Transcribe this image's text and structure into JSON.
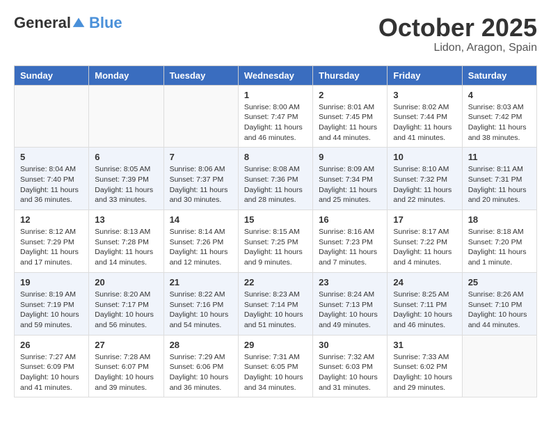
{
  "header": {
    "logo_general": "General",
    "logo_blue": "Blue",
    "title": "October 2025",
    "location": "Lidon, Aragon, Spain"
  },
  "weekdays": [
    "Sunday",
    "Monday",
    "Tuesday",
    "Wednesday",
    "Thursday",
    "Friday",
    "Saturday"
  ],
  "weeks": [
    [
      {
        "day": "",
        "sunrise": "",
        "sunset": "",
        "daylight": ""
      },
      {
        "day": "",
        "sunrise": "",
        "sunset": "",
        "daylight": ""
      },
      {
        "day": "",
        "sunrise": "",
        "sunset": "",
        "daylight": ""
      },
      {
        "day": "1",
        "sunrise": "Sunrise: 8:00 AM",
        "sunset": "Sunset: 7:47 PM",
        "daylight": "Daylight: 11 hours and 46 minutes."
      },
      {
        "day": "2",
        "sunrise": "Sunrise: 8:01 AM",
        "sunset": "Sunset: 7:45 PM",
        "daylight": "Daylight: 11 hours and 44 minutes."
      },
      {
        "day": "3",
        "sunrise": "Sunrise: 8:02 AM",
        "sunset": "Sunset: 7:44 PM",
        "daylight": "Daylight: 11 hours and 41 minutes."
      },
      {
        "day": "4",
        "sunrise": "Sunrise: 8:03 AM",
        "sunset": "Sunset: 7:42 PM",
        "daylight": "Daylight: 11 hours and 38 minutes."
      }
    ],
    [
      {
        "day": "5",
        "sunrise": "Sunrise: 8:04 AM",
        "sunset": "Sunset: 7:40 PM",
        "daylight": "Daylight: 11 hours and 36 minutes."
      },
      {
        "day": "6",
        "sunrise": "Sunrise: 8:05 AM",
        "sunset": "Sunset: 7:39 PM",
        "daylight": "Daylight: 11 hours and 33 minutes."
      },
      {
        "day": "7",
        "sunrise": "Sunrise: 8:06 AM",
        "sunset": "Sunset: 7:37 PM",
        "daylight": "Daylight: 11 hours and 30 minutes."
      },
      {
        "day": "8",
        "sunrise": "Sunrise: 8:08 AM",
        "sunset": "Sunset: 7:36 PM",
        "daylight": "Daylight: 11 hours and 28 minutes."
      },
      {
        "day": "9",
        "sunrise": "Sunrise: 8:09 AM",
        "sunset": "Sunset: 7:34 PM",
        "daylight": "Daylight: 11 hours and 25 minutes."
      },
      {
        "day": "10",
        "sunrise": "Sunrise: 8:10 AM",
        "sunset": "Sunset: 7:32 PM",
        "daylight": "Daylight: 11 hours and 22 minutes."
      },
      {
        "day": "11",
        "sunrise": "Sunrise: 8:11 AM",
        "sunset": "Sunset: 7:31 PM",
        "daylight": "Daylight: 11 hours and 20 minutes."
      }
    ],
    [
      {
        "day": "12",
        "sunrise": "Sunrise: 8:12 AM",
        "sunset": "Sunset: 7:29 PM",
        "daylight": "Daylight: 11 hours and 17 minutes."
      },
      {
        "day": "13",
        "sunrise": "Sunrise: 8:13 AM",
        "sunset": "Sunset: 7:28 PM",
        "daylight": "Daylight: 11 hours and 14 minutes."
      },
      {
        "day": "14",
        "sunrise": "Sunrise: 8:14 AM",
        "sunset": "Sunset: 7:26 PM",
        "daylight": "Daylight: 11 hours and 12 minutes."
      },
      {
        "day": "15",
        "sunrise": "Sunrise: 8:15 AM",
        "sunset": "Sunset: 7:25 PM",
        "daylight": "Daylight: 11 hours and 9 minutes."
      },
      {
        "day": "16",
        "sunrise": "Sunrise: 8:16 AM",
        "sunset": "Sunset: 7:23 PM",
        "daylight": "Daylight: 11 hours and 7 minutes."
      },
      {
        "day": "17",
        "sunrise": "Sunrise: 8:17 AM",
        "sunset": "Sunset: 7:22 PM",
        "daylight": "Daylight: 11 hours and 4 minutes."
      },
      {
        "day": "18",
        "sunrise": "Sunrise: 8:18 AM",
        "sunset": "Sunset: 7:20 PM",
        "daylight": "Daylight: 11 hours and 1 minute."
      }
    ],
    [
      {
        "day": "19",
        "sunrise": "Sunrise: 8:19 AM",
        "sunset": "Sunset: 7:19 PM",
        "daylight": "Daylight: 10 hours and 59 minutes."
      },
      {
        "day": "20",
        "sunrise": "Sunrise: 8:20 AM",
        "sunset": "Sunset: 7:17 PM",
        "daylight": "Daylight: 10 hours and 56 minutes."
      },
      {
        "day": "21",
        "sunrise": "Sunrise: 8:22 AM",
        "sunset": "Sunset: 7:16 PM",
        "daylight": "Daylight: 10 hours and 54 minutes."
      },
      {
        "day": "22",
        "sunrise": "Sunrise: 8:23 AM",
        "sunset": "Sunset: 7:14 PM",
        "daylight": "Daylight: 10 hours and 51 minutes."
      },
      {
        "day": "23",
        "sunrise": "Sunrise: 8:24 AM",
        "sunset": "Sunset: 7:13 PM",
        "daylight": "Daylight: 10 hours and 49 minutes."
      },
      {
        "day": "24",
        "sunrise": "Sunrise: 8:25 AM",
        "sunset": "Sunset: 7:11 PM",
        "daylight": "Daylight: 10 hours and 46 minutes."
      },
      {
        "day": "25",
        "sunrise": "Sunrise: 8:26 AM",
        "sunset": "Sunset: 7:10 PM",
        "daylight": "Daylight: 10 hours and 44 minutes."
      }
    ],
    [
      {
        "day": "26",
        "sunrise": "Sunrise: 7:27 AM",
        "sunset": "Sunset: 6:09 PM",
        "daylight": "Daylight: 10 hours and 41 minutes."
      },
      {
        "day": "27",
        "sunrise": "Sunrise: 7:28 AM",
        "sunset": "Sunset: 6:07 PM",
        "daylight": "Daylight: 10 hours and 39 minutes."
      },
      {
        "day": "28",
        "sunrise": "Sunrise: 7:29 AM",
        "sunset": "Sunset: 6:06 PM",
        "daylight": "Daylight: 10 hours and 36 minutes."
      },
      {
        "day": "29",
        "sunrise": "Sunrise: 7:31 AM",
        "sunset": "Sunset: 6:05 PM",
        "daylight": "Daylight: 10 hours and 34 minutes."
      },
      {
        "day": "30",
        "sunrise": "Sunrise: 7:32 AM",
        "sunset": "Sunset: 6:03 PM",
        "daylight": "Daylight: 10 hours and 31 minutes."
      },
      {
        "day": "31",
        "sunrise": "Sunrise: 7:33 AM",
        "sunset": "Sunset: 6:02 PM",
        "daylight": "Daylight: 10 hours and 29 minutes."
      },
      {
        "day": "",
        "sunrise": "",
        "sunset": "",
        "daylight": ""
      }
    ]
  ]
}
